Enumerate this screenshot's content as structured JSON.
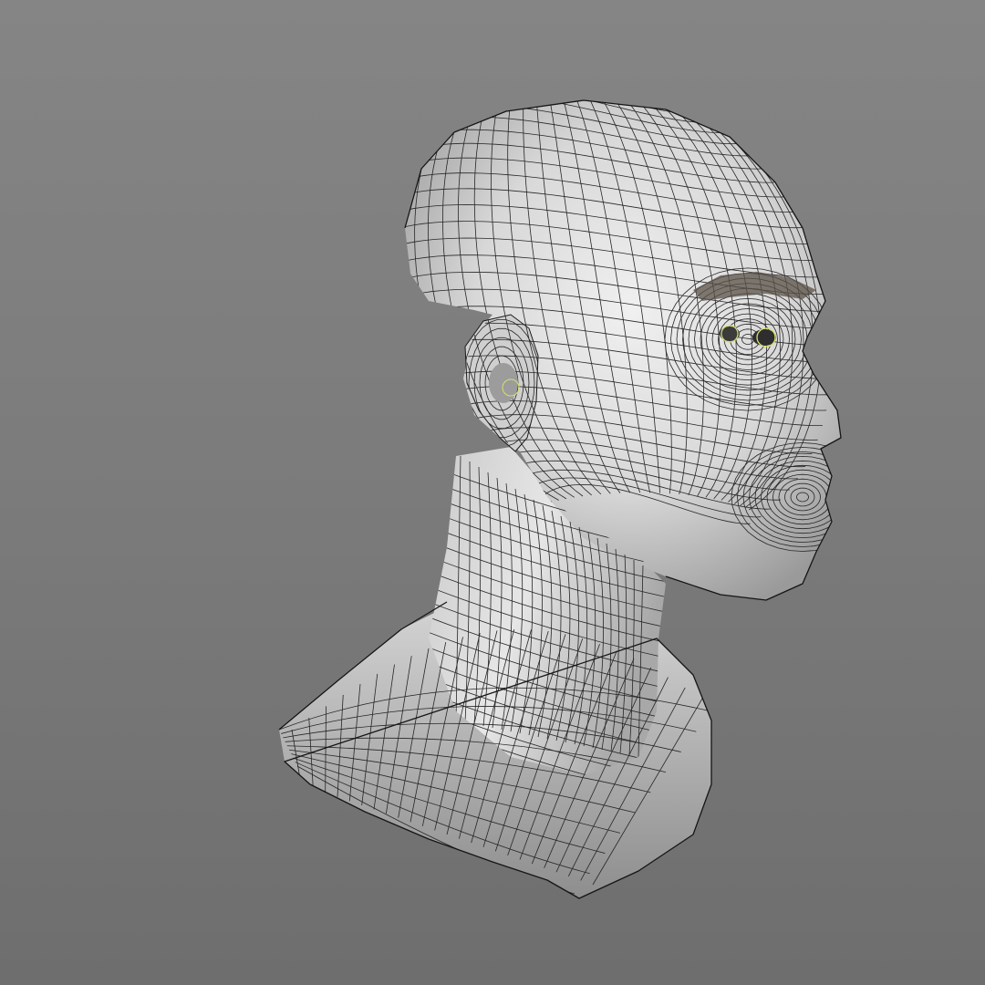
{
  "scene": {
    "subject": "head-bust-wireframe",
    "background_color": "#7b7b7b",
    "surface_color": "#d9d9d9",
    "wire_color": "#1e1e1e",
    "eye_ring_color": "#d8e06a"
  }
}
